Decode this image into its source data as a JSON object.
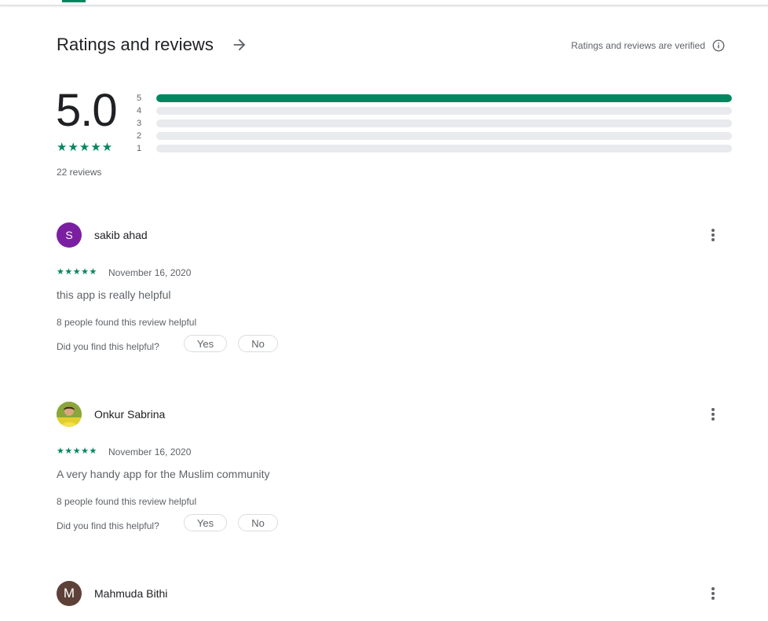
{
  "header": {
    "title": "Ratings and reviews",
    "verified_text": "Ratings and reviews are verified"
  },
  "summary": {
    "score": "5.0",
    "stars": "★★★★★",
    "review_count": "22 reviews",
    "distribution": [
      {
        "label": "5",
        "fraction": 1.0
      },
      {
        "label": "4",
        "fraction": 0
      },
      {
        "label": "3",
        "fraction": 0
      },
      {
        "label": "2",
        "fraction": 0
      },
      {
        "label": "1",
        "fraction": 0
      }
    ]
  },
  "reviews": [
    {
      "avatar_letter": "S",
      "avatar_color": "#7b1fa2",
      "name": "sakib ahad",
      "stars": "★★★★★",
      "date": "November 16, 2020",
      "text": "this app is really helpful",
      "helpful_count": "8 people found this review helpful",
      "question": "Did you find this helpful?",
      "yes": "Yes",
      "no": "No"
    },
    {
      "avatar_letter": "",
      "avatar_color": "#c9b23a",
      "name": "Onkur Sabrina",
      "stars": "★★★★★",
      "date": "November 16, 2020",
      "text": "A very handy app for the Muslim community",
      "helpful_count": "8 people found this review helpful",
      "question": "Did you find this helpful?",
      "yes": "Yes",
      "no": "No"
    },
    {
      "avatar_letter": "M",
      "avatar_color": "#5d4037",
      "name": "Mahmuda Bithi"
    }
  ],
  "colors": {
    "accent": "#01875f",
    "track": "#e8eaed"
  }
}
